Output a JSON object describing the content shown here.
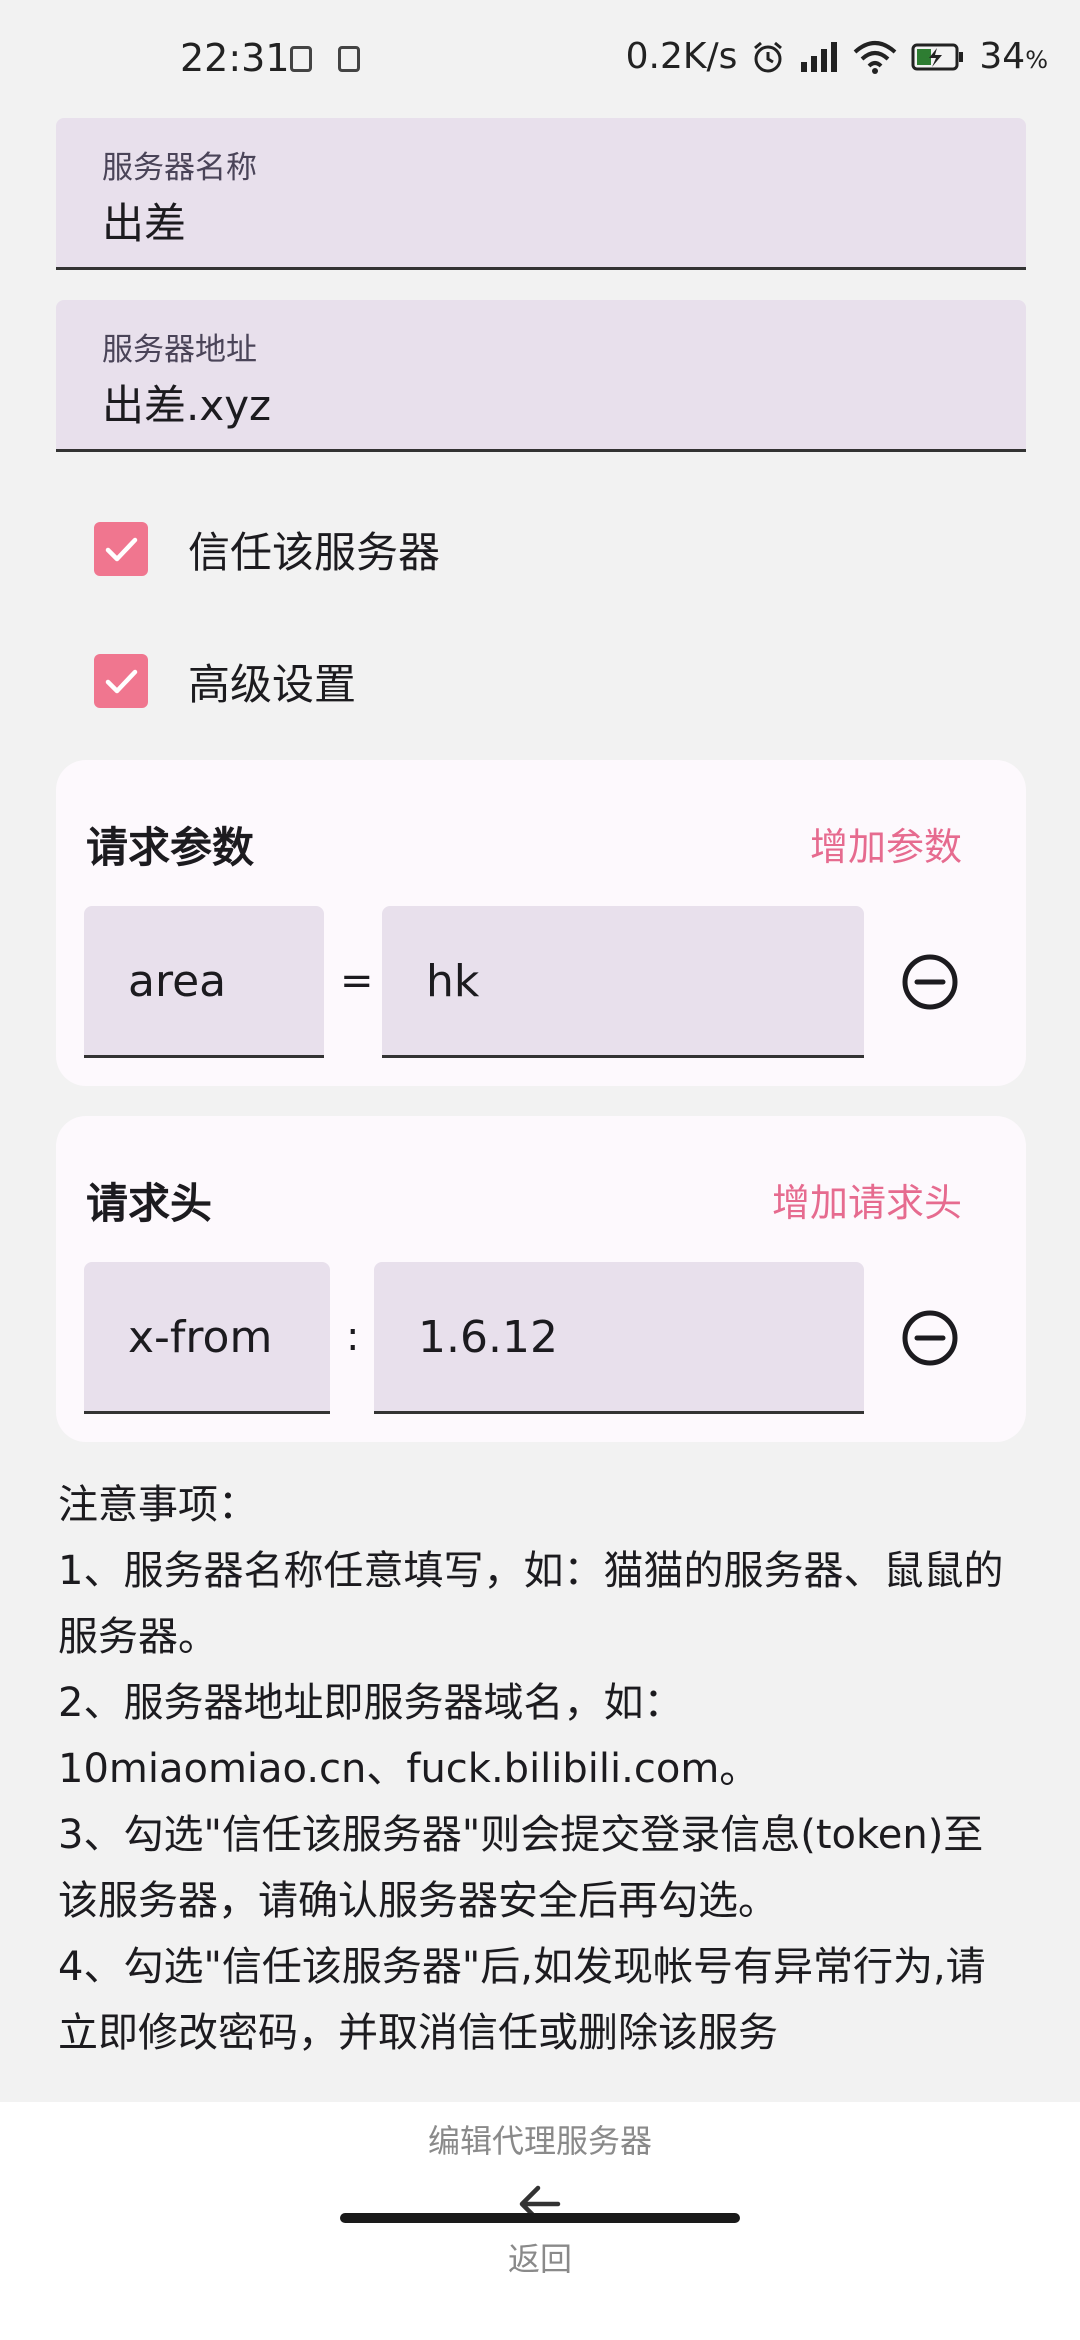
{
  "status_bar": {
    "time": "22:31",
    "network_speed": "0.2K/s",
    "battery": "34",
    "battery_unit": "%"
  },
  "server": {
    "name_label": "服务器名称",
    "name_value": "出差",
    "addr_label": "服务器地址",
    "addr_value": "出差.xyz"
  },
  "options": {
    "trust_label": "信任该服务器",
    "trust_checked": true,
    "advanced_label": "高级设置",
    "advanced_checked": true
  },
  "params_card": {
    "title": "请求参数",
    "add_label": "增加参数",
    "rows": [
      {
        "key": "area",
        "separator": "=",
        "value": "hk"
      }
    ]
  },
  "headers_card": {
    "title": "请求头",
    "add_label": "增加请求头",
    "rows": [
      {
        "key": "x-from",
        "separator": ":",
        "value": "1.6.12"
      }
    ]
  },
  "notes": {
    "heading": "注意事项：",
    "lines": [
      "1、服务器名称任意填写，如：猫猫的服务器、鼠鼠的服务器。",
      "2、服务器地址即服务器域名，如：10miaomiao.cn、fuck.bilibili.com。",
      "3、勾选\"信任该服务器\"则会提交登录信息(token)至该服务器，请确认服务器安全后再勾选。",
      "4、勾选\"信任该服务器\"后,如发现帐号有异常行为,请立即修改密码，并取消信任或删除该服务"
    ]
  },
  "bottom": {
    "title": "编辑代理服务器",
    "back_label": "返回"
  },
  "colors": {
    "accent": "#e66b8f",
    "checkbox": "#f0768f",
    "field_bg": "#e8e0ec"
  }
}
